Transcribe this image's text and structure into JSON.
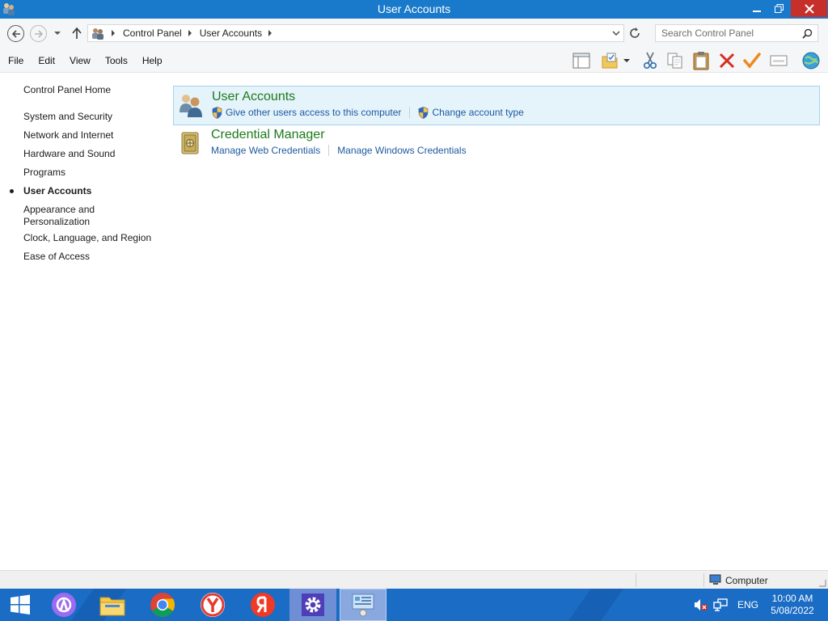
{
  "window": {
    "title": "User Accounts",
    "controls": {
      "minimize": "minimize",
      "maximize": "restore",
      "close": "close"
    }
  },
  "address_bar": {
    "breadcrumbs": [
      "Control Panel",
      "User Accounts"
    ],
    "search_placeholder": "Search Control Panel"
  },
  "menu": [
    "File",
    "Edit",
    "View",
    "Tools",
    "Help"
  ],
  "toolbar_icons": [
    "layout-icon",
    "folder-options-icon",
    "cut-icon",
    "copy-icon",
    "paste-icon",
    "delete-icon",
    "checkmark-icon",
    "properties-icon",
    "globe-icon"
  ],
  "sidebar": {
    "home": "Control Panel Home",
    "items": [
      {
        "label": "System and Security"
      },
      {
        "label": "Network and Internet"
      },
      {
        "label": "Hardware and Sound"
      },
      {
        "label": "Programs"
      },
      {
        "label": "User Accounts",
        "current": true
      },
      {
        "label": "Appearance and Personalization"
      },
      {
        "label": "Clock, Language, and Region"
      },
      {
        "label": "Ease of Access"
      }
    ]
  },
  "categories": [
    {
      "title": "User Accounts",
      "selected": true,
      "links": [
        {
          "label": "Give other users access to this computer",
          "shield": true
        },
        {
          "label": "Change account type",
          "shield": true
        }
      ]
    },
    {
      "title": "Credential Manager",
      "selected": false,
      "links": [
        {
          "label": "Manage Web Credentials",
          "shield": false
        },
        {
          "label": "Manage Windows Credentials",
          "shield": false
        }
      ]
    }
  ],
  "status_bar": {
    "location": "Computer"
  },
  "taskbar": {
    "apps": [
      "start-button",
      "alice-assistant",
      "file-explorer",
      "chrome",
      "yandex-browser",
      "yandex-app",
      "settings",
      "control-panel"
    ],
    "language": "ENG",
    "time": "10:00 AM",
    "date": "5/08/2022"
  },
  "colors": {
    "titlebar": "#1979ca",
    "close_button": "#c7302a",
    "link_blue": "#1e5aa0",
    "category_green": "#1c7a1c",
    "selection_bg": "#e5f3fb",
    "selection_border": "#a6d2ee",
    "taskbar": "#1a6cc4"
  }
}
